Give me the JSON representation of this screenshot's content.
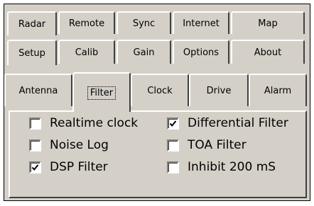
{
  "tabs": {
    "row1": [
      "Radar",
      "Remote",
      "Sync",
      "Internet",
      "Map"
    ],
    "row2": [
      "Setup",
      "Calib",
      "Gain",
      "Options",
      "About"
    ],
    "row3": [
      "Antenna",
      "Filter",
      "Clock",
      "Drive",
      "Alarm"
    ]
  },
  "selected_tab": "Filter",
  "options": {
    "realtime_clock": {
      "label": "Realtime clock",
      "checked": false
    },
    "noise_log": {
      "label": "Noise Log",
      "checked": false
    },
    "dsp_filter": {
      "label": "DSP Filter",
      "checked": true
    },
    "differential_filter": {
      "label": "Differential Filter",
      "checked": true
    },
    "toa_filter": {
      "label": "TOA Filter",
      "checked": false
    },
    "inhibit_200ms": {
      "label": "Inhibit 200 mS",
      "checked": false
    }
  }
}
